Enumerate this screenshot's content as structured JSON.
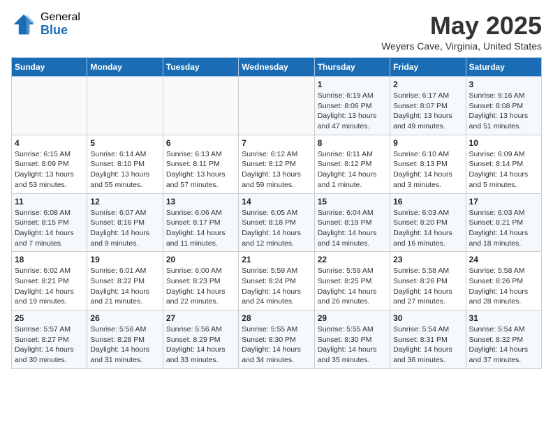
{
  "logo": {
    "general": "General",
    "blue": "Blue"
  },
  "header": {
    "title": "May 2025",
    "subtitle": "Weyers Cave, Virginia, United States"
  },
  "weekdays": [
    "Sunday",
    "Monday",
    "Tuesday",
    "Wednesday",
    "Thursday",
    "Friday",
    "Saturday"
  ],
  "weeks": [
    [
      {
        "day": "",
        "info": ""
      },
      {
        "day": "",
        "info": ""
      },
      {
        "day": "",
        "info": ""
      },
      {
        "day": "",
        "info": ""
      },
      {
        "day": "1",
        "info": "Sunrise: 6:19 AM\nSunset: 8:06 PM\nDaylight: 13 hours\nand 47 minutes."
      },
      {
        "day": "2",
        "info": "Sunrise: 6:17 AM\nSunset: 8:07 PM\nDaylight: 13 hours\nand 49 minutes."
      },
      {
        "day": "3",
        "info": "Sunrise: 6:16 AM\nSunset: 8:08 PM\nDaylight: 13 hours\nand 51 minutes."
      }
    ],
    [
      {
        "day": "4",
        "info": "Sunrise: 6:15 AM\nSunset: 8:09 PM\nDaylight: 13 hours\nand 53 minutes."
      },
      {
        "day": "5",
        "info": "Sunrise: 6:14 AM\nSunset: 8:10 PM\nDaylight: 13 hours\nand 55 minutes."
      },
      {
        "day": "6",
        "info": "Sunrise: 6:13 AM\nSunset: 8:11 PM\nDaylight: 13 hours\nand 57 minutes."
      },
      {
        "day": "7",
        "info": "Sunrise: 6:12 AM\nSunset: 8:12 PM\nDaylight: 13 hours\nand 59 minutes."
      },
      {
        "day": "8",
        "info": "Sunrise: 6:11 AM\nSunset: 8:12 PM\nDaylight: 14 hours\nand 1 minute."
      },
      {
        "day": "9",
        "info": "Sunrise: 6:10 AM\nSunset: 8:13 PM\nDaylight: 14 hours\nand 3 minutes."
      },
      {
        "day": "10",
        "info": "Sunrise: 6:09 AM\nSunset: 8:14 PM\nDaylight: 14 hours\nand 5 minutes."
      }
    ],
    [
      {
        "day": "11",
        "info": "Sunrise: 6:08 AM\nSunset: 8:15 PM\nDaylight: 14 hours\nand 7 minutes."
      },
      {
        "day": "12",
        "info": "Sunrise: 6:07 AM\nSunset: 8:16 PM\nDaylight: 14 hours\nand 9 minutes."
      },
      {
        "day": "13",
        "info": "Sunrise: 6:06 AM\nSunset: 8:17 PM\nDaylight: 14 hours\nand 11 minutes."
      },
      {
        "day": "14",
        "info": "Sunrise: 6:05 AM\nSunset: 8:18 PM\nDaylight: 14 hours\nand 12 minutes."
      },
      {
        "day": "15",
        "info": "Sunrise: 6:04 AM\nSunset: 8:19 PM\nDaylight: 14 hours\nand 14 minutes."
      },
      {
        "day": "16",
        "info": "Sunrise: 6:03 AM\nSunset: 8:20 PM\nDaylight: 14 hours\nand 16 minutes."
      },
      {
        "day": "17",
        "info": "Sunrise: 6:03 AM\nSunset: 8:21 PM\nDaylight: 14 hours\nand 18 minutes."
      }
    ],
    [
      {
        "day": "18",
        "info": "Sunrise: 6:02 AM\nSunset: 8:21 PM\nDaylight: 14 hours\nand 19 minutes."
      },
      {
        "day": "19",
        "info": "Sunrise: 6:01 AM\nSunset: 8:22 PM\nDaylight: 14 hours\nand 21 minutes."
      },
      {
        "day": "20",
        "info": "Sunrise: 6:00 AM\nSunset: 8:23 PM\nDaylight: 14 hours\nand 22 minutes."
      },
      {
        "day": "21",
        "info": "Sunrise: 5:59 AM\nSunset: 8:24 PM\nDaylight: 14 hours\nand 24 minutes."
      },
      {
        "day": "22",
        "info": "Sunrise: 5:59 AM\nSunset: 8:25 PM\nDaylight: 14 hours\nand 26 minutes."
      },
      {
        "day": "23",
        "info": "Sunrise: 5:58 AM\nSunset: 8:26 PM\nDaylight: 14 hours\nand 27 minutes."
      },
      {
        "day": "24",
        "info": "Sunrise: 5:58 AM\nSunset: 8:26 PM\nDaylight: 14 hours\nand 28 minutes."
      }
    ],
    [
      {
        "day": "25",
        "info": "Sunrise: 5:57 AM\nSunset: 8:27 PM\nDaylight: 14 hours\nand 30 minutes."
      },
      {
        "day": "26",
        "info": "Sunrise: 5:56 AM\nSunset: 8:28 PM\nDaylight: 14 hours\nand 31 minutes."
      },
      {
        "day": "27",
        "info": "Sunrise: 5:56 AM\nSunset: 8:29 PM\nDaylight: 14 hours\nand 33 minutes."
      },
      {
        "day": "28",
        "info": "Sunrise: 5:55 AM\nSunset: 8:30 PM\nDaylight: 14 hours\nand 34 minutes."
      },
      {
        "day": "29",
        "info": "Sunrise: 5:55 AM\nSunset: 8:30 PM\nDaylight: 14 hours\nand 35 minutes."
      },
      {
        "day": "30",
        "info": "Sunrise: 5:54 AM\nSunset: 8:31 PM\nDaylight: 14 hours\nand 36 minutes."
      },
      {
        "day": "31",
        "info": "Sunrise: 5:54 AM\nSunset: 8:32 PM\nDaylight: 14 hours\nand 37 minutes."
      }
    ]
  ]
}
